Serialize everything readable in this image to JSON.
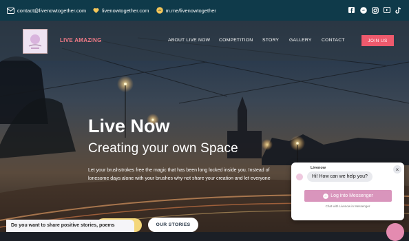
{
  "colors": {
    "topbar": "#0f3a4a",
    "accent": "#ee5a6d",
    "brand": "#f07a86",
    "chat_button": "#d995bc"
  },
  "topbar": {
    "email": "contact@livenowtogether.com",
    "website": "livenowtogether.com",
    "messenger": "m.me/livenowtogether",
    "social_icons": [
      "facebook-icon",
      "messenger-icon",
      "instagram-icon",
      "youtube-icon",
      "tiktok-icon"
    ]
  },
  "nav": {
    "brand_prefix": "LIVE",
    "brand_suffix": "AMAZING",
    "links": [
      "ABOUT LIVE NOW",
      "COMPETITION",
      "STORY",
      "GALLERY",
      "CONTACT"
    ],
    "join_label": "JOIN US"
  },
  "hero": {
    "headline": "Live Now",
    "subheadline": "Creating your own Space",
    "paragraph_line1": "Let your brushstrokes free the magic that has been long locked inside you. Instead of",
    "paragraph_line2": "lonesome days alone with your brushes why not share your creation and let everyone",
    "stories_label": "OUR STORIES"
  },
  "bottom_prompt": "Do you want to share positive stories, poems",
  "chat": {
    "name": "Livenow",
    "greeting": "Hi! How can we help you?",
    "login_label": "Log into Messenger",
    "footer": "Chat with Livenow in Messenger",
    "close_symbol": "×"
  }
}
